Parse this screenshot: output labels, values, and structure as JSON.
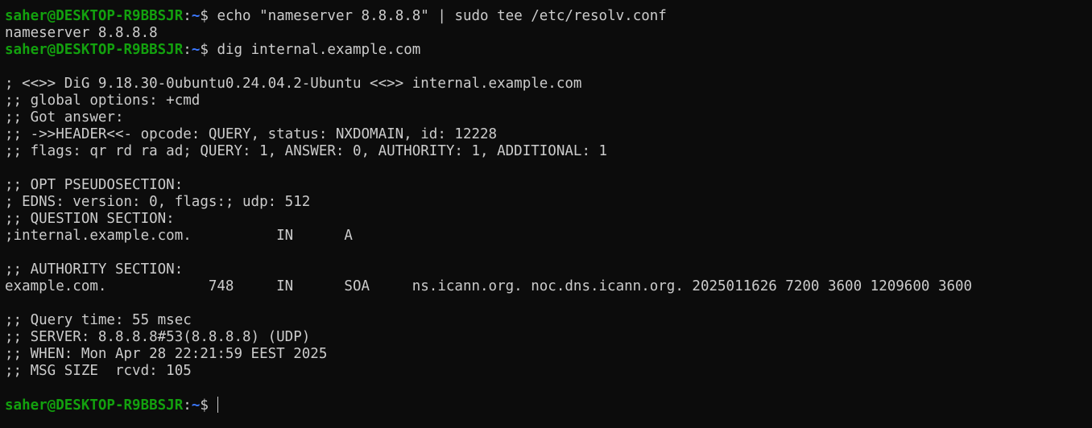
{
  "terminal": {
    "prompt": {
      "user_host": "saher@DESKTOP-R9BBSJR",
      "separator": ":",
      "path": "~",
      "symbol": "$ "
    },
    "lines": [
      {
        "kind": "prompt",
        "command": "echo \"nameserver 8.8.8.8\" | sudo tee /etc/resolv.conf"
      },
      {
        "kind": "output",
        "text": "nameserver 8.8.8.8"
      },
      {
        "kind": "prompt",
        "command": "dig internal.example.com"
      },
      {
        "kind": "output",
        "text": ""
      },
      {
        "kind": "output",
        "text": "; <<>> DiG 9.18.30-0ubuntu0.24.04.2-Ubuntu <<>> internal.example.com"
      },
      {
        "kind": "output",
        "text": ";; global options: +cmd"
      },
      {
        "kind": "output",
        "text": ";; Got answer:"
      },
      {
        "kind": "output",
        "text": ";; ->>HEADER<<- opcode: QUERY, status: NXDOMAIN, id: 12228"
      },
      {
        "kind": "output",
        "text": ";; flags: qr rd ra ad; QUERY: 1, ANSWER: 0, AUTHORITY: 1, ADDITIONAL: 1"
      },
      {
        "kind": "output",
        "text": ""
      },
      {
        "kind": "output",
        "text": ";; OPT PSEUDOSECTION:"
      },
      {
        "kind": "output",
        "text": "; EDNS: version: 0, flags:; udp: 512"
      },
      {
        "kind": "output",
        "text": ";; QUESTION SECTION:"
      },
      {
        "kind": "output",
        "text": ";internal.example.com.          IN      A"
      },
      {
        "kind": "output",
        "text": ""
      },
      {
        "kind": "output",
        "text": ";; AUTHORITY SECTION:"
      },
      {
        "kind": "output",
        "text": "example.com.            748     IN      SOA     ns.icann.org. noc.dns.icann.org. 2025011626 7200 3600 1209600 3600"
      },
      {
        "kind": "output",
        "text": ""
      },
      {
        "kind": "output",
        "text": ";; Query time: 55 msec"
      },
      {
        "kind": "output",
        "text": ";; SERVER: 8.8.8.8#53(8.8.8.8) (UDP)"
      },
      {
        "kind": "output",
        "text": ";; WHEN: Mon Apr 28 22:21:59 EEST 2025"
      },
      {
        "kind": "output",
        "text": ";; MSG SIZE  rcvd: 105"
      },
      {
        "kind": "output",
        "text": ""
      },
      {
        "kind": "prompt",
        "command": "",
        "cursor": true
      }
    ]
  },
  "colors": {
    "background": "#0c0c0c",
    "foreground": "#cccccc",
    "user_host": "#13a10e",
    "path": "#3b78ff"
  }
}
